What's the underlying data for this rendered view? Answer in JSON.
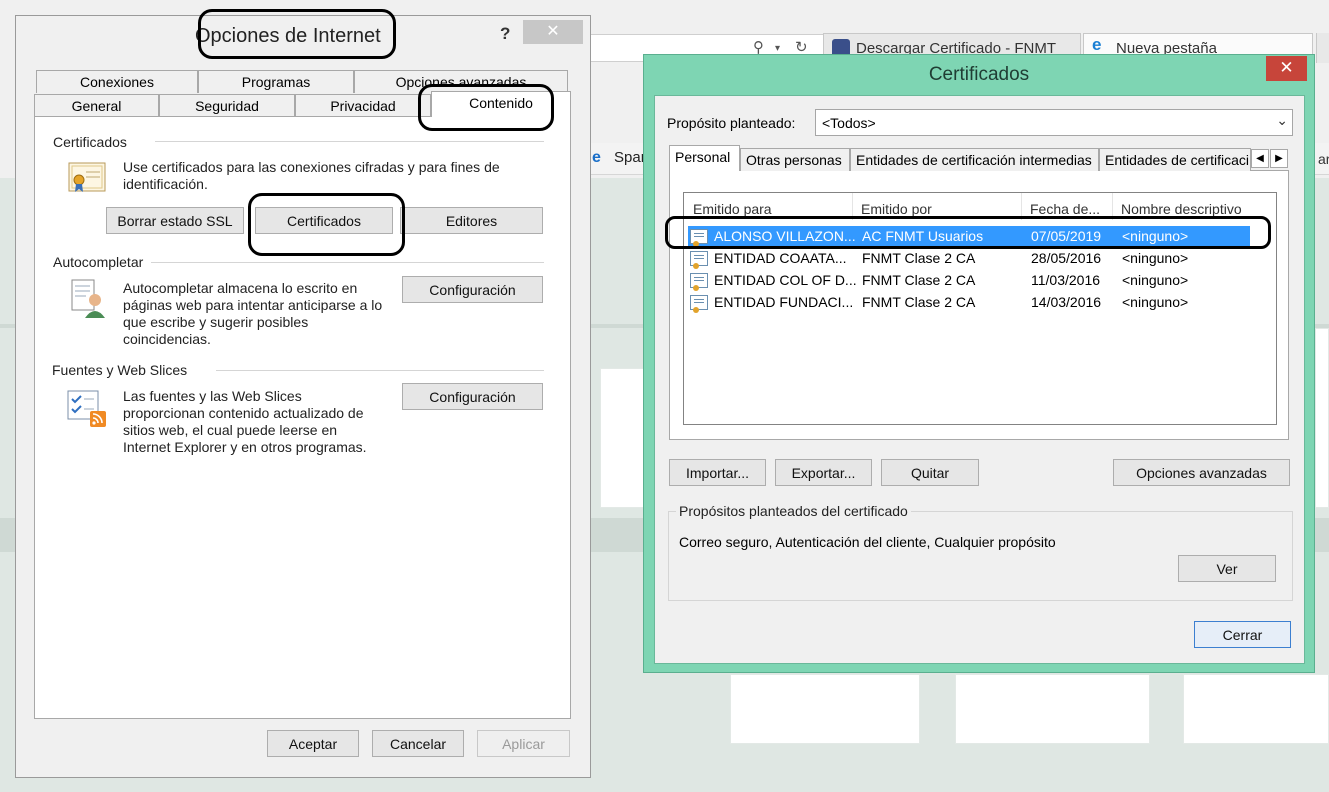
{
  "browser": {
    "tabs": [
      {
        "label": "Descargar Certificado - FNMT"
      },
      {
        "label": "Nueva pestaña"
      }
    ],
    "favorites": {
      "item": "Spar",
      "right_item": "ari"
    }
  },
  "inet_dialog": {
    "title": "Opciones de Internet",
    "help": "?",
    "close": "✕",
    "tabs_row1": [
      "Conexiones",
      "Programas",
      "Opciones avanzadas"
    ],
    "tabs_row2": [
      "General",
      "Seguridad",
      "Privacidad",
      "Contenido"
    ],
    "selected_tab": "Contenido",
    "certificados": {
      "title": "Certificados",
      "description": "Use certificados para las conexiones cifradas y para fines de identificación.",
      "buttons": [
        "Borrar estado SSL",
        "Certificados",
        "Editores"
      ]
    },
    "autocompletar": {
      "title": "Autocompletar",
      "description": "Autocompletar almacena lo escrito en páginas web para intentar anticiparse a lo que escribe y sugerir posibles coincidencias.",
      "button": "Configuración"
    },
    "fuentes": {
      "title": "Fuentes y Web Slices",
      "description": "Las fuentes y las Web Slices proporcionan contenido actualizado de sitios web, el cual puede leerse en Internet Explorer y en otros programas.",
      "button": "Configuración"
    },
    "footer_buttons": {
      "accept": "Aceptar",
      "cancel": "Cancelar",
      "apply": "Aplicar"
    }
  },
  "cert_dialog": {
    "title": "Certificados",
    "close": "✕",
    "purpose_label": "Propósito planteado:",
    "purpose_value": "<Todos>",
    "tabs": [
      "Personal",
      "Otras personas",
      "Entidades de certificación intermedias",
      "Entidades de certificaci"
    ],
    "selected_tab": "Personal",
    "columns": [
      "Emitido para",
      "Emitido por",
      "Fecha de...",
      "Nombre descriptivo"
    ],
    "rows": [
      {
        "issued_to": "ALONSO VILLAZON...",
        "issued_by": "AC FNMT Usuarios",
        "date": "07/05/2019",
        "friendly_name": "<ninguno>",
        "selected": true
      },
      {
        "issued_to": "ENTIDAD COAATA...",
        "issued_by": "FNMT Clase 2 CA",
        "date": "28/05/2016",
        "friendly_name": "<ninguno>",
        "selected": false
      },
      {
        "issued_to": "ENTIDAD COL OF D...",
        "issued_by": "FNMT Clase 2 CA",
        "date": "11/03/2016",
        "friendly_name": "<ninguno>",
        "selected": false
      },
      {
        "issued_to": "ENTIDAD FUNDACI...",
        "issued_by": "FNMT Clase 2 CA",
        "date": "14/03/2016",
        "friendly_name": "<ninguno>",
        "selected": false
      }
    ],
    "buttons": {
      "import": "Importar...",
      "export": "Exportar...",
      "remove": "Quitar",
      "advanced": "Opciones avanzadas"
    },
    "purposes_group": {
      "title": "Propósitos planteados del certificado",
      "value": "Correo seguro, Autenticación del cliente, Cualquier propósito",
      "view_button": "Ver"
    },
    "close_button": "Cerrar",
    "selection_color": "#3399ff",
    "accent_color": "#7ed5b3"
  }
}
